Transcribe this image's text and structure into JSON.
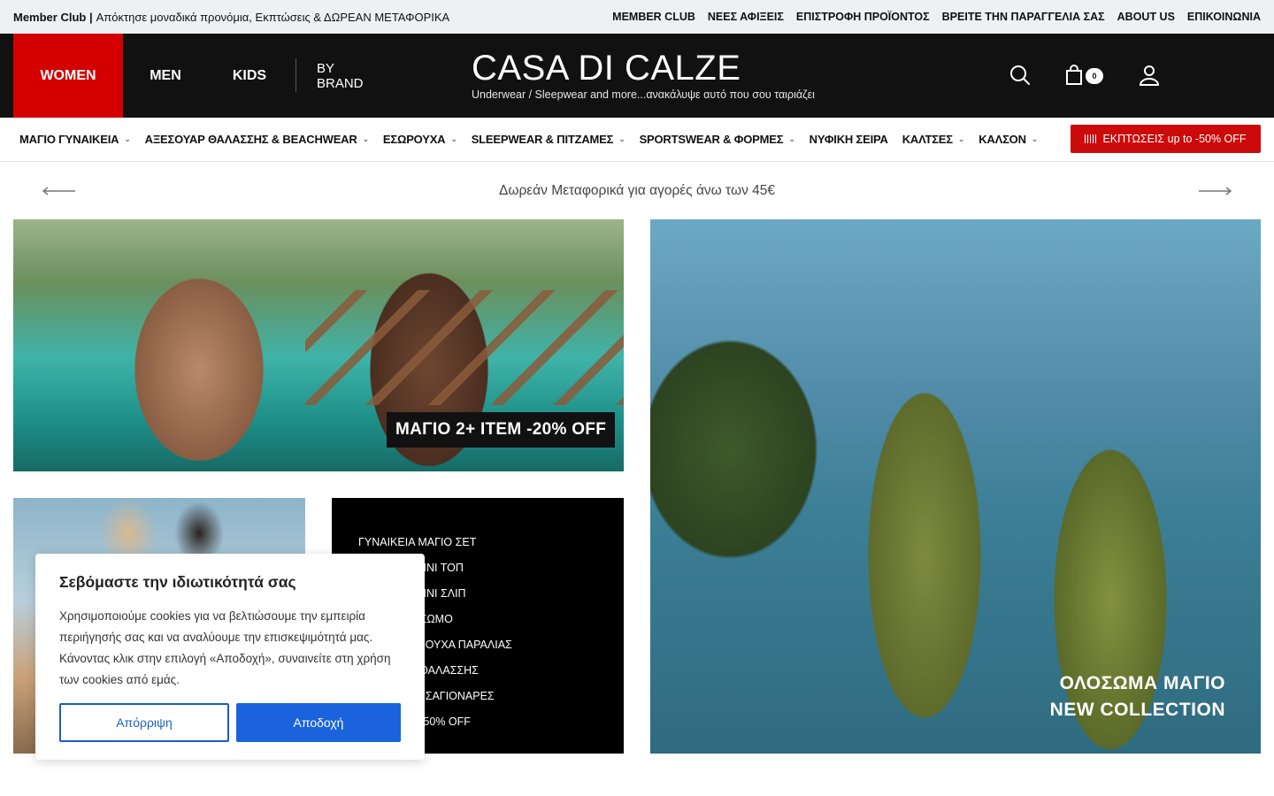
{
  "topbar": {
    "promo_bold": "Member Club |",
    "promo_text": "Απόκτησε μοναδικά προνόμια, Εκπτώσεις & ΔΩΡΕΑΝ ΜΕΤΑΦΟΡΙΚΑ",
    "links": [
      "MEMBER CLUB",
      "ΝΕΕΣ ΑΦΙΞΕΙΣ",
      "ΕΠΙΣΤΡΟΦΗ ΠΡΟΪΟΝΤΟΣ",
      "ΒΡΕΙΤΕ ΤΗΝ ΠΑΡΑΓΓΕΛΙΑ ΣΑΣ",
      "ABOUT US",
      "ΕΠΙΚΟΙΝΩΝΙΑ"
    ]
  },
  "header": {
    "women": "WOMEN",
    "men": "MEN",
    "kids": "KIDS",
    "by_brand": "BY BRAND",
    "logo_name": "CASA DI CALZE",
    "logo_tagline": "Underwear / Sleepwear and more...ανακάλυψε αυτό που σου ταιριάζει",
    "cart_count": "0",
    "accent_color": "#d40000"
  },
  "catnav": {
    "items": [
      {
        "label": "ΜΑΓΙΟ ΓΥΝΑΙΚΕΙΑ",
        "dropdown": true
      },
      {
        "label": "ΑΞΕΣΟΥΑΡ ΘΑΛΑΣΣΗΣ & BEACHWEAR",
        "dropdown": true
      },
      {
        "label": "ΕΣΩΡΟΥΧΑ",
        "dropdown": true
      },
      {
        "label": "SLEEPWEAR & ΠΙΤΖΑΜΕΣ",
        "dropdown": true
      },
      {
        "label": "SPORTSWEAR & ΦΟΡΜΕΣ",
        "dropdown": true
      },
      {
        "label": "ΝΥΦΙΚΗ ΣΕΙΡΑ",
        "dropdown": false
      },
      {
        "label": "ΚΑΛΤΣΕΣ",
        "dropdown": true
      },
      {
        "label": "ΚΑΛΣΟΝ",
        "dropdown": true
      }
    ],
    "sale_label": "ΕΚΠΤΩΣΕΙΣ up to -50% OFF"
  },
  "announcement": {
    "text": "Δωρεάν Μεταφορικά για αγορές άνω των 45€"
  },
  "banners": {
    "top_left_label": "ΜΑΓΙΟ 2+ ITEM -20% OFF",
    "right_label_1": "ΟΛΟΣΩΜΑ ΜΑΓΙΟ",
    "right_label_2": "NEW COLLECTION",
    "menu_list": [
      "ΓΥΝΑΙΚΕΙΑ ΜΑΓΙΟ ΣΕΤ",
      "ΜΑΓΙΟ ΜΠΙΚΙΝΙ ΤΟΠ",
      "ΜΑΓΙΟ ΜΠΙΚΙΝΙ ΣΛΙΠ",
      "ΜΑΓΙΟ ΟΛΟΣΩΜΟ",
      "ΓΥΝΑΙΚΕΙΑ ΡΟΥΧΑ ΠΑΡΑΛΙΑΣ",
      "ΑΞΕΣΟΥΑΡ ΘΑΛΑΣΣΗΣ",
      "ΓΥΝΑΙΚΕΙΕΣ ΣΑΓΙΟΝΑΡΕΣ",
      "ΜΑΓΙΟ ΣΕΤ -50% OFF"
    ]
  },
  "cookie": {
    "title": "Σεβόμαστε την ιδιωτικότητά σας",
    "body": "Χρησιμοποιούμε cookies για να βελτιώσουμε την εμπειρία περιήγησής σας και να αναλύουμε την επισκεψιμότητά μας. Κάνοντας κλικ στην επιλογή «Αποδοχή», συναινείτε στη χρήση των cookies από εμάς.",
    "reject": "Απόρριψη",
    "accept": "Αποδοχή",
    "button_color": "#1a63dc"
  }
}
